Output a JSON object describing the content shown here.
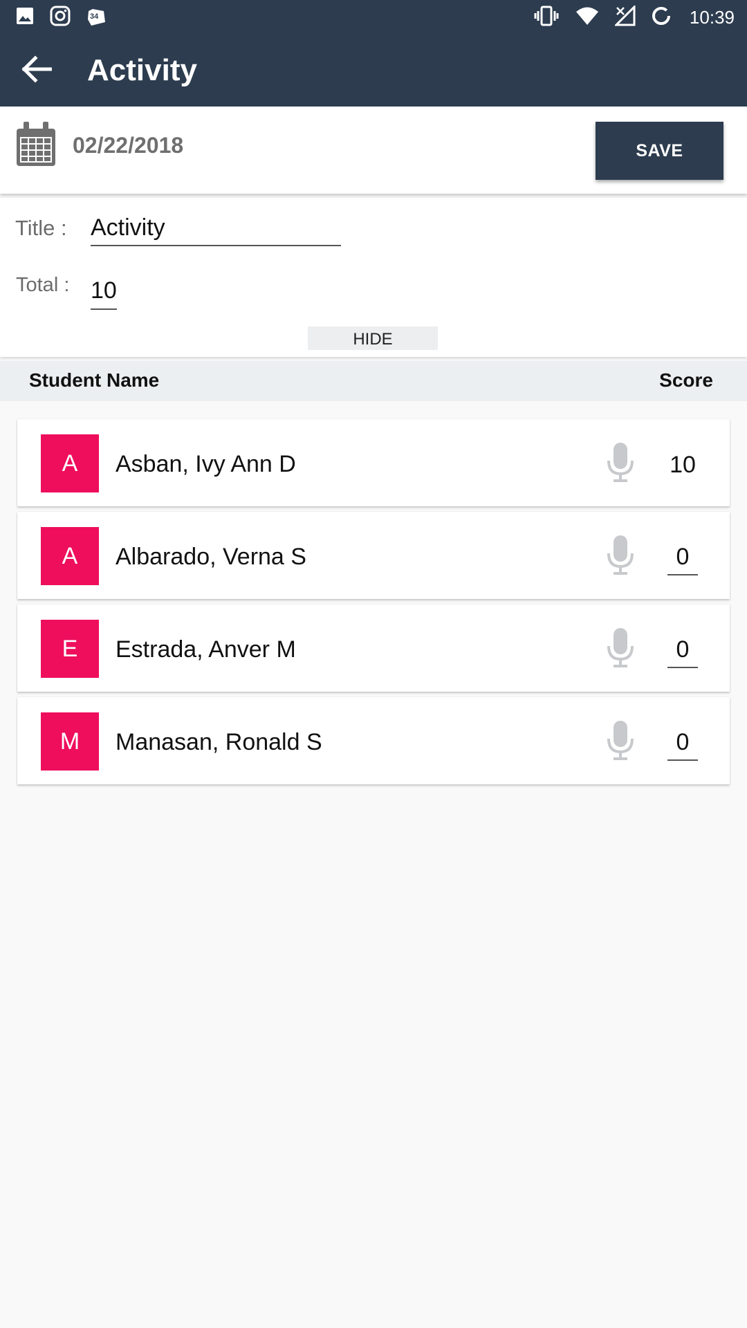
{
  "status_bar": {
    "left_icons": [
      "image-icon",
      "instagram-icon",
      "notification-badge-icon"
    ],
    "badge_text": "34",
    "right_icons": [
      "vibrate-icon",
      "wifi-icon",
      "no-signal-icon",
      "sync-icon"
    ],
    "time": "10:39"
  },
  "app_bar": {
    "back_icon": "arrow-back-icon",
    "title": "Activity"
  },
  "date_panel": {
    "calendar_icon": "calendar-icon",
    "date": "02/22/2018",
    "save_label": "SAVE"
  },
  "form": {
    "title_label": "Title :",
    "title_value": "Activity",
    "total_label": "Total :",
    "total_value": "10",
    "hide_label": "HIDE"
  },
  "list_header": {
    "name_col": "Student Name",
    "score_col": "Score"
  },
  "students": [
    {
      "initial": "A",
      "name": "Asban, Ivy Ann D",
      "score": "10"
    },
    {
      "initial": "A",
      "name": "Albarado, Verna S",
      "score": "0"
    },
    {
      "initial": "E",
      "name": "Estrada, Anver M",
      "score": "0"
    },
    {
      "initial": "M",
      "name": "Manasan, Ronald S",
      "score": "0"
    }
  ],
  "colors": {
    "primary": "#2d3c4f",
    "avatar": "#ee0e5c",
    "background": "#f9f9f9",
    "header_strip": "#eceff1"
  }
}
